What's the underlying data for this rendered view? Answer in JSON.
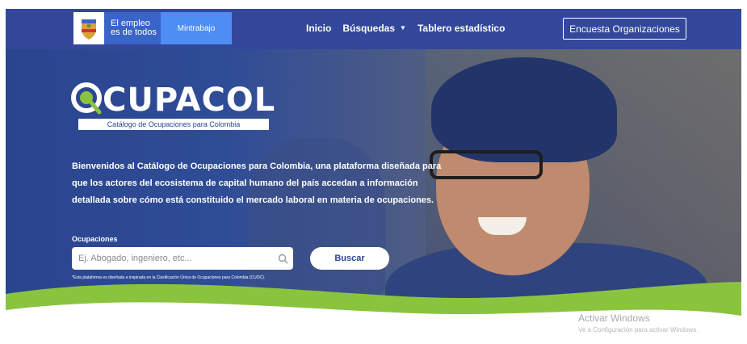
{
  "nav": {
    "gov_line1": "El empleo",
    "gov_line2": "es de todos",
    "ministry": "Mintrabajo",
    "links": [
      "Inicio",
      "Búsquedas",
      "Tablero estadístico"
    ],
    "survey_button": "Encuesta Organizaciones"
  },
  "hero": {
    "logo_word": "CUPACOL",
    "logo_subtitle": "Catálogo de Ocupaciones para Colombia",
    "intro": "Bienvenidos al Catálogo de Ocupaciones para Colombia, una plataforma diseñada para que los actores del ecosistema de capital humano del país accedan a información detallada sobre cómo está constituido el mercado laboral en materia de ocupaciones.",
    "search_label": "Ocupaciones",
    "search_placeholder": "Ej. Abogado, ingeniero, etc...",
    "search_button": "Buscar",
    "footnote": "*Esta plataforma es diseñada e inspirada en la Clasificación Única de Ocupaciones para Colombia (CUOC)."
  },
  "watermark": {
    "line1": "Activar Windows",
    "line2": "Ve a Configuración para activar Windows."
  },
  "colors": {
    "primary": "#33489a",
    "accent_green": "#8ac43f",
    "ministry_blue": "#4e8df4"
  },
  "icons": [
    "colombia-crest-icon",
    "search-icon",
    "chevron-down-icon",
    "magnifier-logo-icon"
  ]
}
